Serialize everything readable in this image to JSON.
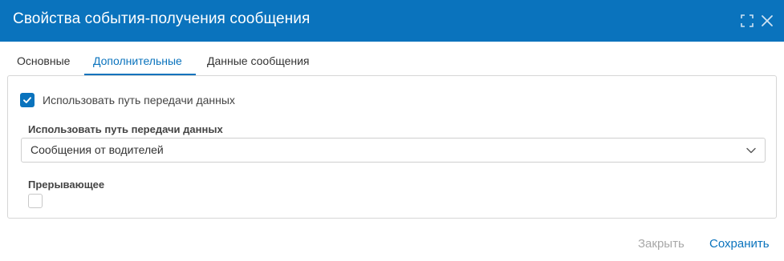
{
  "dialog": {
    "title": "Свойства события-получения сообщения",
    "icons": {
      "maximize": "maximize-icon",
      "close": "close-icon"
    }
  },
  "tabs": [
    {
      "label": "Основные",
      "active": false
    },
    {
      "label": "Дополнительные",
      "active": true
    },
    {
      "label": "Данные сообщения",
      "active": false
    }
  ],
  "panel": {
    "use_path_checkbox": {
      "label": "Использовать путь передачи данных",
      "checked": true
    },
    "path_field": {
      "label": "Использовать путь передачи данных",
      "value": "Сообщения от водителей"
    },
    "interrupting": {
      "label": "Прерывающее",
      "checked": false
    }
  },
  "footer": {
    "close_label": "Закрыть",
    "save_label": "Сохранить"
  },
  "colors": {
    "accent": "#0a73bd",
    "disabled": "#a8a8a8",
    "border": "#d6d6d6"
  }
}
